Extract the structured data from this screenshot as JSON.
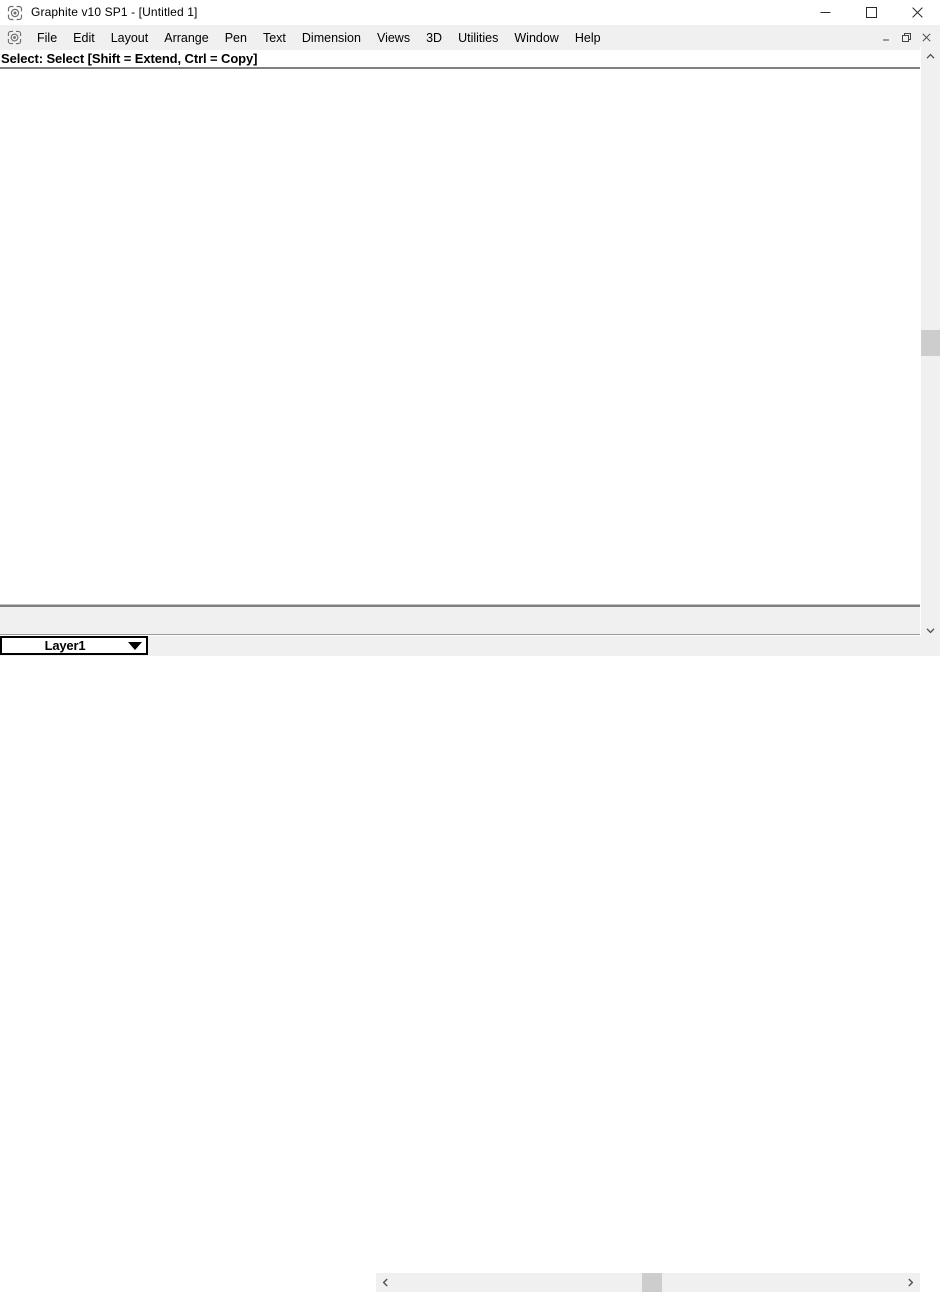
{
  "window": {
    "title": "Graphite v10 SP1 - [Untitled 1]",
    "app_icon": "graphite-app-icon",
    "controls": {
      "minimize_label": "Minimize",
      "maximize_label": "Maximize",
      "close_label": "Close"
    }
  },
  "menubar": {
    "icon": "graphite-document-icon",
    "items": [
      {
        "label": "File"
      },
      {
        "label": "Edit"
      },
      {
        "label": "Layout"
      },
      {
        "label": "Arrange"
      },
      {
        "label": "Pen"
      },
      {
        "label": "Text"
      },
      {
        "label": "Dimension"
      },
      {
        "label": "Views"
      },
      {
        "label": "3D"
      },
      {
        "label": "Utilities"
      },
      {
        "label": "Window"
      },
      {
        "label": "Help"
      }
    ],
    "mdi_controls": {
      "minimize_label": "Minimize Document",
      "restore_label": "Restore Document",
      "close_label": "Close Document"
    }
  },
  "prompt": {
    "text": "Select: Select  [Shift = Extend, Ctrl = Copy]"
  },
  "canvas": {
    "background": "#ffffff"
  },
  "status": {
    "layer": {
      "value": "Layer1",
      "arrow_icon": "chevron-down-icon"
    }
  },
  "scrollbars": {
    "vertical": {
      "up_icon": "chevron-up-icon",
      "down_icon": "chevron-down-icon",
      "thumb_position_percent": 51
    },
    "horizontal": {
      "left_icon": "chevron-left-icon",
      "right_icon": "chevron-right-icon",
      "thumb_position_percent": 50
    }
  },
  "colors": {
    "window_background": "#ffffff",
    "menubar_background": "#f0f0f0",
    "scrollbar_track": "#f0f0f0",
    "scrollbar_thumb": "#cdcdcd",
    "divider": "#808080",
    "text": "#000000"
  }
}
